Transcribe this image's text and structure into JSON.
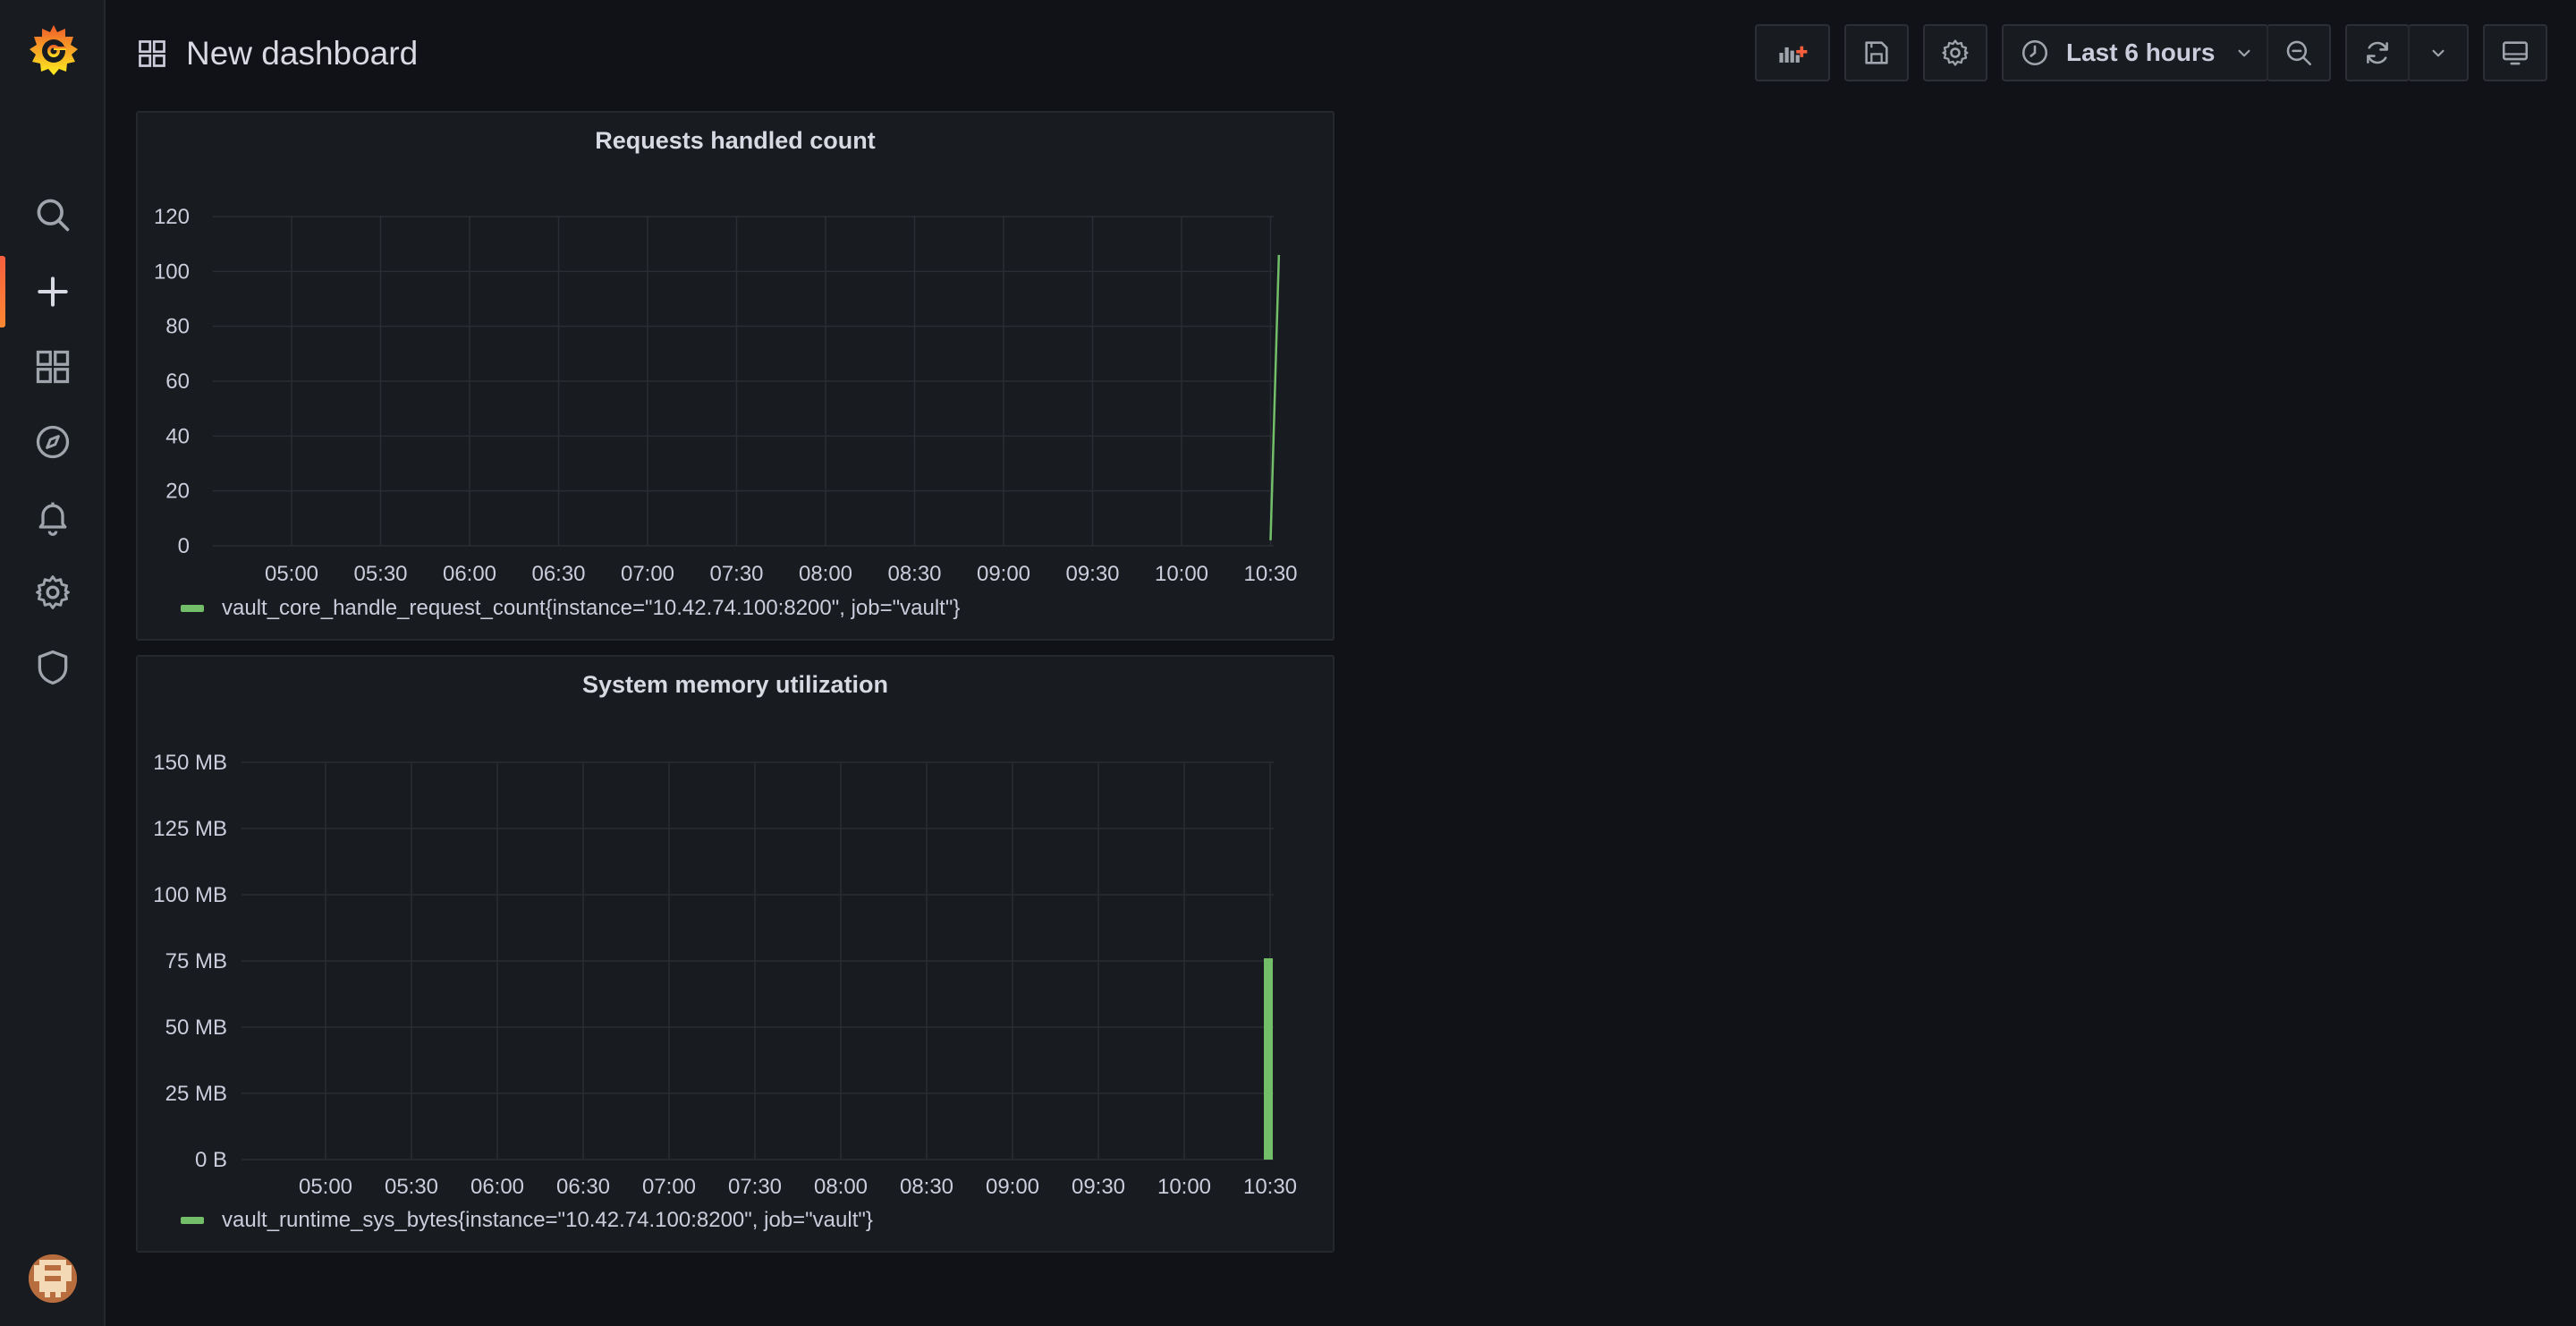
{
  "dashboard": {
    "title": "New dashboard"
  },
  "sidebar": {
    "items": [
      {
        "name": "search",
        "icon": "search-icon"
      },
      {
        "name": "create",
        "icon": "plus-icon",
        "active": true
      },
      {
        "name": "dashboards",
        "icon": "dashboards-grid-icon"
      },
      {
        "name": "explore",
        "icon": "compass-icon"
      },
      {
        "name": "alerting",
        "icon": "bell-icon"
      },
      {
        "name": "configuration",
        "icon": "gear-icon"
      },
      {
        "name": "server-admin",
        "icon": "shield-icon"
      }
    ]
  },
  "toolbar": {
    "time_range": "Last 6 hours",
    "buttons": [
      "add-panel-icon",
      "save-icon",
      "gear-icon",
      "clock-icon",
      "zoom-out-icon",
      "refresh-icon",
      "chevron-down-icon",
      "tv-monitor-icon"
    ]
  },
  "colors": {
    "series": "#73bf69",
    "accent": "#f55f3e",
    "background": "#111217",
    "panel": "#181b1f"
  },
  "panels": [
    {
      "title": "Requests handled count",
      "legend": "vault_core_handle_request_count{instance=\"10.42.74.100:8200\", job=\"vault\"}",
      "chart_data": {
        "type": "line",
        "title": "Requests handled count",
        "x_ticks": [
          "05:00",
          "05:30",
          "06:00",
          "06:30",
          "07:00",
          "07:30",
          "08:00",
          "08:30",
          "09:00",
          "09:30",
          "10:00",
          "10:30"
        ],
        "y_ticks": [
          "0",
          "20",
          "40",
          "60",
          "80",
          "100",
          "120"
        ],
        "ylim": [
          0,
          120
        ],
        "series": [
          {
            "name": "vault_core_handle_request_count{instance=\"10.42.74.100:8200\", job=\"vault\"}",
            "x": [
              "10:30",
              "10:31"
            ],
            "y": [
              2,
              106
            ]
          }
        ],
        "grid": true,
        "legend_position": "bottom-left"
      }
    },
    {
      "title": "System memory utilization",
      "legend": "vault_runtime_sys_bytes{instance=\"10.42.74.100:8200\", job=\"vault\"}",
      "chart_data": {
        "type": "bar",
        "title": "System memory utilization",
        "x_ticks": [
          "05:00",
          "05:30",
          "06:00",
          "06:30",
          "07:00",
          "07:30",
          "08:00",
          "08:30",
          "09:00",
          "09:30",
          "10:00",
          "10:30"
        ],
        "y_ticks": [
          "0 B",
          "25 MB",
          "50 MB",
          "75 MB",
          "100 MB",
          "125 MB",
          "150 MB"
        ],
        "ylim": [
          0,
          150
        ],
        "series": [
          {
            "name": "vault_runtime_sys_bytes{instance=\"10.42.74.100:8200\", job=\"vault\"}",
            "x": [
              "10:30"
            ],
            "y": [
              76
            ]
          }
        ],
        "grid": true,
        "legend_position": "bottom-left"
      }
    }
  ]
}
